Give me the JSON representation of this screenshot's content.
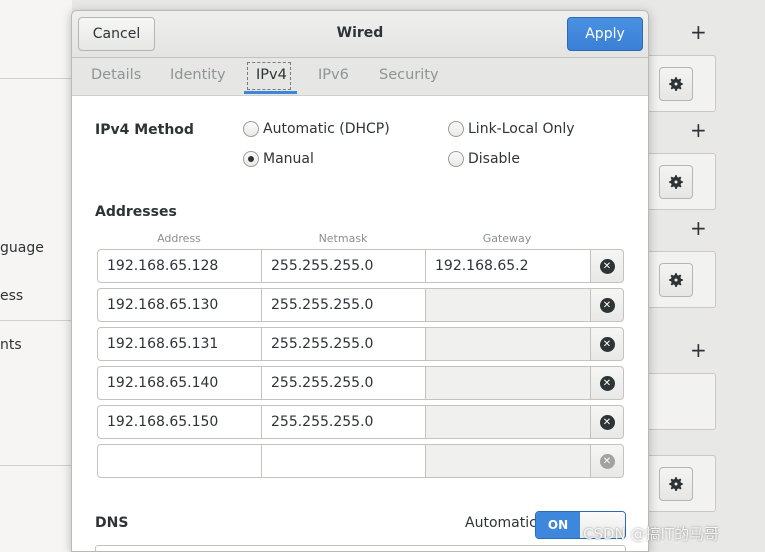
{
  "background": {
    "left_labels": [
      "guage",
      "ess",
      "nts"
    ]
  },
  "dialog": {
    "title": "Wired",
    "cancel_label": "Cancel",
    "apply_label": "Apply",
    "tabs": [
      {
        "label": "Details",
        "active": false
      },
      {
        "label": "Identity",
        "active": false
      },
      {
        "label": "IPv4",
        "active": true
      },
      {
        "label": "IPv6",
        "active": false
      },
      {
        "label": "Security",
        "active": false
      }
    ],
    "ipv4_method": {
      "label": "IPv4 Method",
      "options": [
        {
          "label": "Automatic (DHCP)",
          "checked": false
        },
        {
          "label": "Link-Local Only",
          "checked": false
        },
        {
          "label": "Manual",
          "checked": true
        },
        {
          "label": "Disable",
          "checked": false
        }
      ]
    },
    "addresses": {
      "label": "Addresses",
      "columns": [
        "Address",
        "Netmask",
        "Gateway"
      ],
      "rows": [
        {
          "address": "192.168.65.128",
          "netmask": "255.255.255.0",
          "gateway": "192.168.65.2"
        },
        {
          "address": "192.168.65.130",
          "netmask": "255.255.255.0",
          "gateway": ""
        },
        {
          "address": "192.168.65.131",
          "netmask": "255.255.255.0",
          "gateway": ""
        },
        {
          "address": "192.168.65.140",
          "netmask": "255.255.255.0",
          "gateway": ""
        },
        {
          "address": "192.168.65.150",
          "netmask": "255.255.255.0",
          "gateway": ""
        },
        {
          "address": "",
          "netmask": "",
          "gateway": ""
        }
      ]
    },
    "dns": {
      "label": "DNS",
      "automatic_label": "Automatic",
      "toggle_state": "ON"
    }
  },
  "watermark": "CSDN @搞IT的马哥",
  "colors": {
    "accent": "#3d87dc",
    "apply_button": "#4a90e2"
  },
  "icons": [
    "gear-icon",
    "plus-icon",
    "clear-icon"
  ]
}
